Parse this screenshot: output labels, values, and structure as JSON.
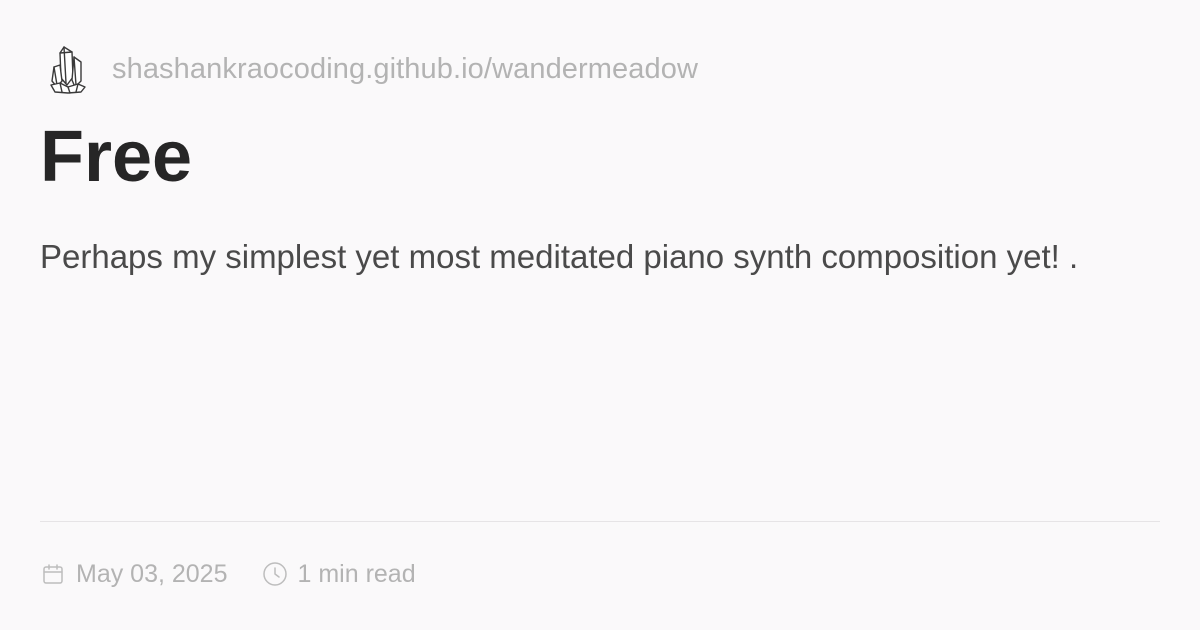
{
  "site": {
    "url": "shashankraocoding.github.io/wandermeadow",
    "logo_icon": "crystal-cluster-icon"
  },
  "post": {
    "title": "Free",
    "description": "Perhaps my simplest yet most meditated piano synth composition yet! ."
  },
  "meta": {
    "date": "May 03, 2025",
    "date_icon": "calendar-icon",
    "read_time": "1 min read",
    "read_time_icon": "clock-icon"
  },
  "colors": {
    "background": "#faf9fa",
    "title": "#262626",
    "description": "#4a4a4a",
    "muted": "#b3b3b3",
    "divider": "#e6e4e6"
  }
}
